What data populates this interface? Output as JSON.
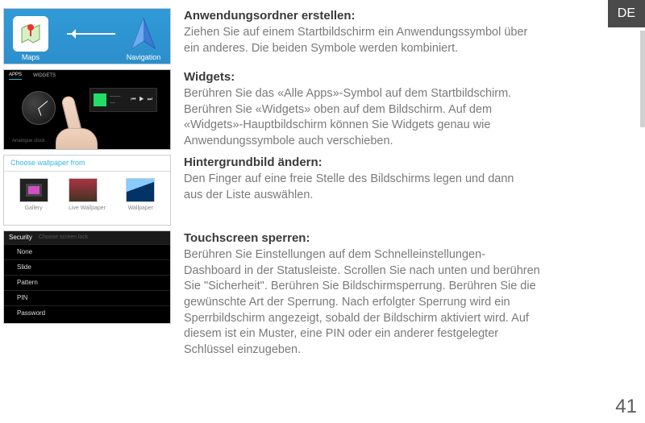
{
  "lang_badge": "DE",
  "page_number": "41",
  "thumb1": {
    "app_left_label": "Maps",
    "app_right_label": "Navigation"
  },
  "thumb2": {
    "tab_apps": "APPS",
    "tab_widgets": "WIDGETS",
    "caption": "Analogue clock"
  },
  "thumb3": {
    "header": "Choose wallpaper from",
    "opt1": "Gallery",
    "opt2": "Live Wallpaper",
    "opt3": "Wallpaper"
  },
  "thumb4": {
    "header": "Security",
    "sub": "Choose screen lock",
    "opt_none": "None",
    "opt_slide": "Slide",
    "opt_pattern": "Pattern",
    "opt_pin": "PIN",
    "opt_password": "Password"
  },
  "section1": {
    "heading": "Anwendungsordner erstellen:",
    "body": "Ziehen Sie auf einem Startbildschirm ein Anwendungssymbol über ein anderes. Die beiden Symbole werden kombiniert."
  },
  "section2": {
    "heading": "Widgets:",
    "body": "Berühren Sie das «Alle Apps»-Symbol auf dem Startbildschirm. Berühren Sie «Widgets» oben auf dem Bildschirm. Auf dem «Widgets»-Hauptbildschirm können Sie Widgets genau wie Anwendungssymbole auch verschieben."
  },
  "section3": {
    "heading": "Hintergrundbild ändern:",
    "body": "Den Finger auf eine freie Stelle des Bildschirms legen und dann aus der Liste auswählen."
  },
  "section4": {
    "heading": "Touchscreen sperren:",
    "body": "Berühren Sie Einstellungen auf dem Schnelleinstellungen-Dashboard in der Statusleiste. Scrollen Sie nach unten und berühren Sie \"Sicherheit\". Berühren Sie  Bildschirmsperrung. Berühren Sie die gewünschte Art der Sperrung. Nach erfolgter Sperrung wird ein Sperrbildschirm angezeigt, sobald der Bildschirm aktiviert wird. Auf diesem ist ein Muster, eine PIN oder ein anderer festgelegter Schlüssel einzugeben."
  }
}
